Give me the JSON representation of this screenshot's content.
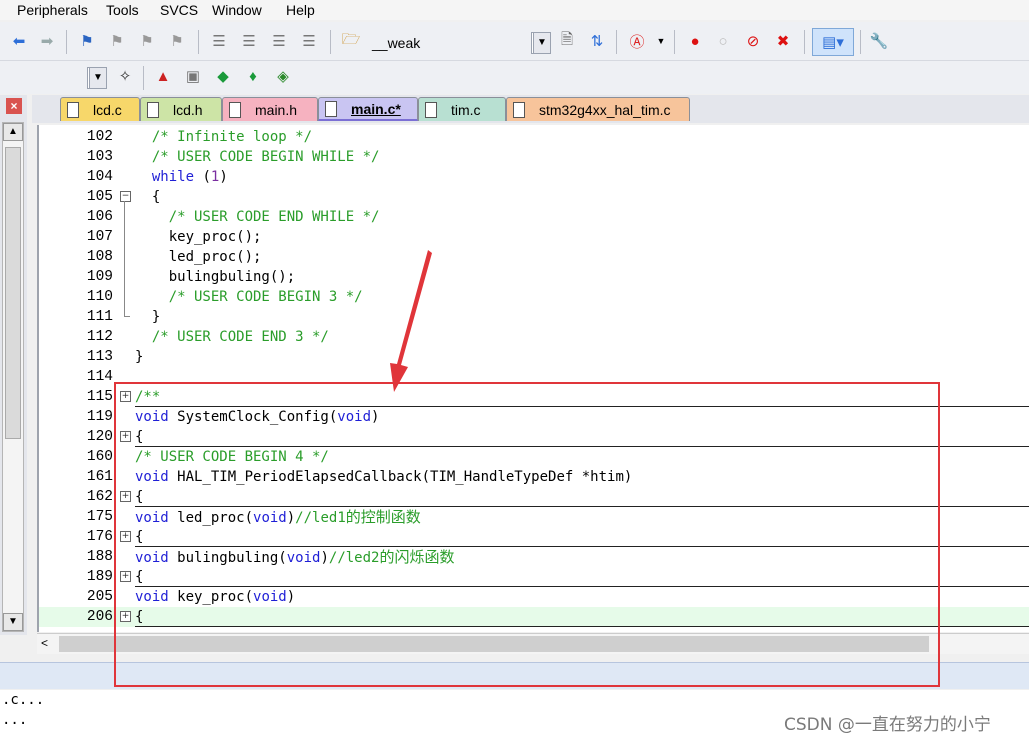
{
  "menu": [
    "Peripherals",
    "Tools",
    "SVCS",
    "Window",
    "Help"
  ],
  "toolbar": {
    "target_combo_value": "__weak",
    "icons": [
      "back-arrow",
      "forward-arrow",
      "bookmark",
      "bookmark-prev",
      "bookmark-next",
      "bookmark-clear",
      "indent",
      "unindent",
      "comment",
      "uncomment",
      "find-in-files",
      "find",
      "debug",
      "breakpoint",
      "breakpoint-disable",
      "breakpoint-clear",
      "breakpoint-kill",
      "window-layout",
      "configure"
    ]
  },
  "tabs": [
    {
      "label": "lcd.c",
      "color": "#f7d76a",
      "active": false
    },
    {
      "label": "lcd.h",
      "color": "#cde4a6",
      "active": false
    },
    {
      "label": "main.h",
      "color": "#f6b2c0",
      "active": false
    },
    {
      "label": "main.c*",
      "color": "#c9c5f2",
      "active": true
    },
    {
      "label": "tim.c",
      "color": "#b8e0d2",
      "active": false
    },
    {
      "label": "stm32g4xx_hal_tim.c",
      "color": "#f7c49b",
      "active": false
    }
  ],
  "lines": [
    {
      "n": "102",
      "fold": "",
      "parts": [
        {
          "t": "  "
        },
        {
          "t": "/* Infinite loop */",
          "c": "cm"
        }
      ]
    },
    {
      "n": "103",
      "fold": "",
      "parts": [
        {
          "t": "  "
        },
        {
          "t": "/* USER CODE BEGIN WHILE */",
          "c": "cm"
        }
      ]
    },
    {
      "n": "104",
      "fold": "",
      "parts": [
        {
          "t": "  "
        },
        {
          "t": "while",
          "c": "kw"
        },
        {
          "t": " ("
        },
        {
          "t": "1",
          "c": "num"
        },
        {
          "t": ")"
        }
      ]
    },
    {
      "n": "105",
      "fold": "minus",
      "parts": [
        {
          "t": "  {"
        }
      ]
    },
    {
      "n": "106",
      "fold": "",
      "parts": [
        {
          "t": "    "
        },
        {
          "t": "/* USER CODE END WHILE */",
          "c": "cm"
        }
      ]
    },
    {
      "n": "107",
      "fold": "",
      "parts": [
        {
          "t": "    key_proc();"
        }
      ]
    },
    {
      "n": "108",
      "fold": "",
      "parts": [
        {
          "t": "    led_proc();"
        }
      ]
    },
    {
      "n": "109",
      "fold": "",
      "parts": [
        {
          "t": "    bulingbuling();"
        }
      ]
    },
    {
      "n": "110",
      "fold": "",
      "parts": [
        {
          "t": "    "
        },
        {
          "t": "/* USER CODE BEGIN 3 */",
          "c": "cm"
        }
      ]
    },
    {
      "n": "111",
      "fold": "end",
      "parts": [
        {
          "t": "  }"
        }
      ]
    },
    {
      "n": "112",
      "fold": "",
      "parts": [
        {
          "t": "  "
        },
        {
          "t": "/* USER CODE END 3 */",
          "c": "cm"
        }
      ]
    },
    {
      "n": "113",
      "fold": "",
      "parts": [
        {
          "t": "}"
        }
      ]
    },
    {
      "n": "114",
      "fold": "",
      "parts": []
    },
    {
      "n": "115",
      "fold": "plus",
      "parts": [
        {
          "t": "/**",
          "c": "cm"
        }
      ]
    },
    {
      "n": "119",
      "fold": "",
      "parts": [
        {
          "t": "void",
          "c": "kw"
        },
        {
          "t": " SystemClock_Config("
        },
        {
          "t": "void",
          "c": "kw"
        },
        {
          "t": ")"
        }
      ]
    },
    {
      "n": "120",
      "fold": "plus",
      "parts": [
        {
          "t": "{"
        }
      ]
    },
    {
      "n": "160",
      "fold": "",
      "parts": [
        {
          "t": "/* USER CODE BEGIN 4 */",
          "c": "cm"
        }
      ]
    },
    {
      "n": "161",
      "fold": "",
      "parts": [
        {
          "t": "void",
          "c": "kw"
        },
        {
          "t": " HAL_TIM_PeriodElapsedCallback(TIM_HandleTypeDef *htim)"
        }
      ]
    },
    {
      "n": "162",
      "fold": "plus",
      "parts": [
        {
          "t": "{"
        }
      ]
    },
    {
      "n": "175",
      "fold": "",
      "parts": [
        {
          "t": "void",
          "c": "kw"
        },
        {
          "t": " led_proc("
        },
        {
          "t": "void",
          "c": "kw"
        },
        {
          "t": ")"
        },
        {
          "t": "//led1",
          "c": "cm"
        },
        {
          "t": "的控制函数",
          "c": "cmz"
        }
      ]
    },
    {
      "n": "176",
      "fold": "plus",
      "parts": [
        {
          "t": "{"
        }
      ]
    },
    {
      "n": "188",
      "fold": "",
      "parts": [
        {
          "t": "void",
          "c": "kw"
        },
        {
          "t": " bulingbuling("
        },
        {
          "t": "void",
          "c": "kw"
        },
        {
          "t": ")"
        },
        {
          "t": "//led2",
          "c": "cm"
        },
        {
          "t": "的闪烁函数",
          "c": "cmz"
        }
      ]
    },
    {
      "n": "189",
      "fold": "plus",
      "parts": [
        {
          "t": "{"
        }
      ]
    },
    {
      "n": "205",
      "fold": "",
      "parts": [
        {
          "t": "void",
          "c": "kw"
        },
        {
          "t": " key_proc("
        },
        {
          "t": "void",
          "c": "kw"
        },
        {
          "t": ")"
        }
      ]
    },
    {
      "n": "206",
      "fold": "plus",
      "parts": [
        {
          "t": "{"
        }
      ],
      "highlight": true
    }
  ],
  "bottom_text": [
    ".c...",
    "..."
  ],
  "watermark": "CSDN @一直在努力的小宁"
}
